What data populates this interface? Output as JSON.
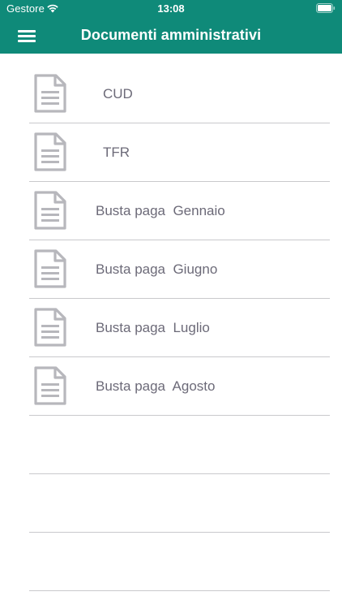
{
  "status_bar": {
    "carrier": "Gestore",
    "time": "13:08"
  },
  "header": {
    "title": "Documenti amministrativi",
    "menu_icon": "hamburger-menu-icon"
  },
  "documents": [
    {
      "label": "CUD",
      "icon": "document-icon"
    },
    {
      "label": "TFR",
      "icon": "document-icon"
    },
    {
      "label": "Busta paga  Gennaio",
      "icon": "document-icon"
    },
    {
      "label": "Busta paga  Giugno",
      "icon": "document-icon"
    },
    {
      "label": "Busta paga  Luglio",
      "icon": "document-icon"
    },
    {
      "label": "Busta paga  Agosto",
      "icon": "document-icon"
    }
  ],
  "colors": {
    "header_background": "#0f8a79",
    "header_text": "#ffffff",
    "row_text": "#6c6a78",
    "icon": "#b7b7bc",
    "separator": "#c9c9cc"
  }
}
